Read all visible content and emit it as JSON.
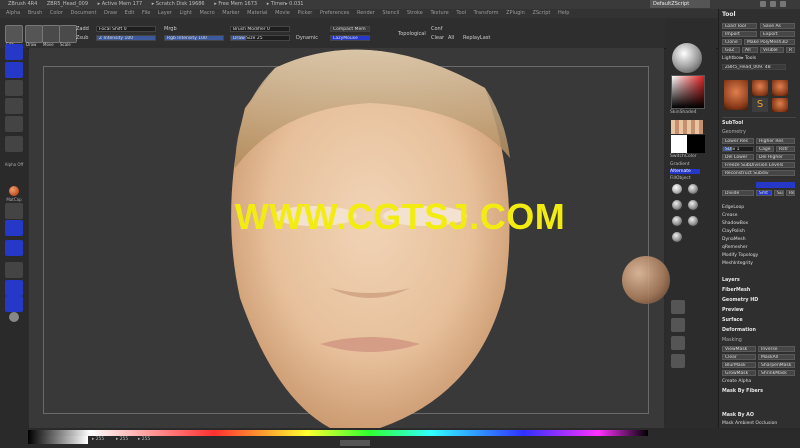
{
  "title_bar": {
    "items": [
      "ZBrush 4R4",
      "ZBR5_Head_009",
      "▸ Active Mem 177",
      "▸ Scratch Disk 19686",
      "▸ Free Mem 1673",
      "▸ Timer▸ 0.031"
    ],
    "right_label": "DefaultZScript"
  },
  "menu": [
    "Alpha",
    "Brush",
    "Color",
    "Document",
    "Draw",
    "Edit",
    "File",
    "Layer",
    "Light",
    "Macro",
    "Marker",
    "Material",
    "Movie",
    "Picker",
    "Preferences",
    "Render",
    "Stencil",
    "Stroke",
    "Texture",
    "Tool",
    "Transform",
    "ZPlugin",
    "ZScript",
    "Help"
  ],
  "toolbar": {
    "edit": "Edit",
    "draw": "Draw",
    "move": "Move",
    "scale": "Scale",
    "rotate": "Rotate",
    "zadd": "Zadd",
    "zsub": "Zsub",
    "zcut": "Zcut",
    "focal_shift_label": "Focal Shift 0",
    "focal_shift_value": 0,
    "z_intensity_label": "Z Intensity 100",
    "z_intensity_value": 100,
    "mrgb": "Mrgb",
    "rgb": "Rgb",
    "m": "M",
    "rgb_intensity_label": "Rgb Intensity 100",
    "rgb_intensity_value": 100,
    "brush_modifier_label": "Brush Modifier 0",
    "draw_size_label": "Draw Size 25",
    "draw_size_value": 25,
    "dynamic": "Dynamic",
    "lazy_mouse": "LazyMouse",
    "compact_mem": "Compact Mem",
    "topological": "Topological",
    "conf": "Conf",
    "clear": "Clear",
    "all": "All",
    "replay_last": "ReplayLast",
    "lazymouse_toggle": "LazyMouse"
  },
  "left_shelf": [
    "Projection",
    "Move",
    "Standard",
    "Inflate",
    "ClayBuildup",
    "Smooth",
    "TrimDynamic",
    "Pinch",
    "hPolish",
    "Alpha Off",
    "MatCap",
    "Texture Off",
    "Dots",
    "Stroke",
    "Mask",
    "Floor"
  ],
  "right_column": {
    "material_label": "SkinShade4",
    "swatch_label": "Gradient",
    "switch_color": "SwitchColor",
    "alternate": "Alternate",
    "fill_object": "FillObject",
    "brushes": [
      "Clay",
      "ClayBuildup",
      "Move",
      "hPolish",
      "Pinch",
      "Standard",
      "Dam_Std"
    ],
    "nav_buttons": [
      "Frame",
      "Move",
      "Scale",
      "Rotate",
      "PolyF",
      "Transp",
      "Solo",
      "Xpose"
    ]
  },
  "tool_palette": {
    "title": "Tool",
    "buttons": [
      "Load Tool",
      "Save As",
      "Import",
      "Export",
      "Clone",
      "Make PolyMesh3D",
      "GoZ",
      "All",
      "Visible",
      "R",
      "Lightbox▸ Tools"
    ],
    "current_tool": "ZBR5_Head_009. 48",
    "thumbs": [
      "ZBR5_Head_009",
      "Cylinder3D",
      "SimpleBrush",
      "PolyMesh3D"
    ],
    "subpalettes": [
      "SubTool",
      "Geometry",
      "Lower Res",
      "Higher Res",
      "SDiv 1",
      "Cage",
      "Rstr",
      "Del Lower",
      "Del Higher",
      "Freeze SubDivision Levels",
      "Reconstruct Subdiv",
      "Divide",
      "Smt",
      "Suv",
      "ReUV",
      "EdgeLoop",
      "Crease",
      "ShadowBox",
      "ClayPolish",
      "DynaMesh",
      "qRemesher",
      "Modify Topology",
      "MeshIntegrity"
    ],
    "sections": [
      "Layers",
      "FiberMesh",
      "Geometry HD",
      "Preview",
      "Surface",
      "Deformation",
      "Masking"
    ],
    "masking": [
      "ViewMask",
      "Inverse",
      "Clear",
      "MaskAll",
      "BlurMask",
      "SharpenMask",
      "GrowMask",
      "ShrinkMask",
      "Create Alpha"
    ],
    "extra": [
      "Mask By Fibers",
      "Mask By AO",
      "Mask Ambient Occlusion",
      "Occlusion Intensity 1",
      "AO ScanDist",
      "AO Aperture"
    ]
  },
  "bottom": {
    "slider_vals": [
      "▸ 255",
      "▸ 255",
      "▸ 255"
    ]
  },
  "watermark": "WWW.CGTSJ.COM",
  "colors": {
    "accent": "#2638c8",
    "watermark": "#f3ec11",
    "skin": "#e3b890"
  }
}
